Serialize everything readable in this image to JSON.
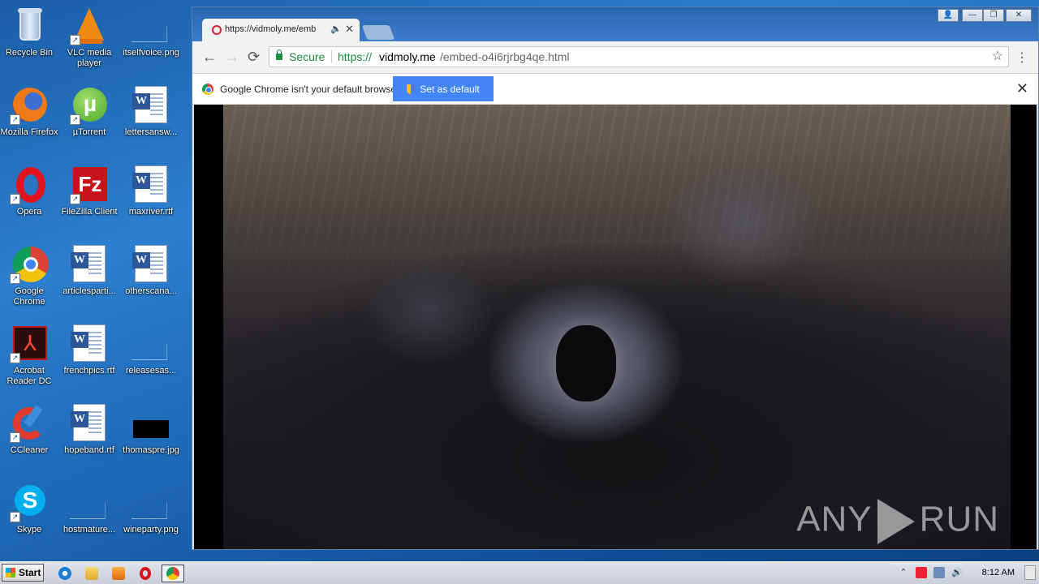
{
  "desktop": {
    "icons": [
      {
        "label": "Recycle Bin"
      },
      {
        "label": "VLC media player"
      },
      {
        "label": "itselfvoice.png"
      },
      {
        "label": "Mozilla Firefox"
      },
      {
        "label": "µTorrent"
      },
      {
        "label": "lettersansw..."
      },
      {
        "label": "Opera"
      },
      {
        "label": "FileZilla Client"
      },
      {
        "label": "maxriver.rtf"
      },
      {
        "label": "Google Chrome"
      },
      {
        "label": "articlesparti..."
      },
      {
        "label": "otherscana..."
      },
      {
        "label": "Acrobat Reader DC"
      },
      {
        "label": "frenchpics.rtf"
      },
      {
        "label": "releasesas..."
      },
      {
        "label": "CCleaner"
      },
      {
        "label": "hopeband.rtf"
      },
      {
        "label": "thomaspre.jpg"
      },
      {
        "label": "Skype"
      },
      {
        "label": "hostmature..."
      },
      {
        "label": "wineparty.png"
      }
    ]
  },
  "browser": {
    "tab": {
      "title": "https://vidmoly.me/emb",
      "audio_icon": "🔈",
      "close": "✕"
    },
    "controls": {
      "account": "👤",
      "minimize": "—",
      "restore": "❐",
      "close": "✕"
    },
    "nav": {
      "back": "←",
      "forward": "→",
      "reload": "⟳"
    },
    "omnibox": {
      "secure_label": "Secure",
      "url_scheme": "https://",
      "url_host": "vidmoly.me",
      "url_path": "/embed-o4i6rjrbg4qe.html",
      "star": "☆"
    },
    "menu": "⋮",
    "infobar": {
      "message": "Google Chrome isn't your default browser.",
      "button": "Set as default",
      "close": "✕"
    },
    "watermark": {
      "left": "ANY",
      "right": "RUN"
    }
  },
  "taskbar": {
    "start_label": "Start",
    "clock": "8:12 AM",
    "tray_arrow": "⌃",
    "volume": "🔊"
  },
  "colors": {
    "secure_green": "#1e8e3e",
    "infobar_button": "#4285f4",
    "desktop_blue": "#1d69b7"
  }
}
